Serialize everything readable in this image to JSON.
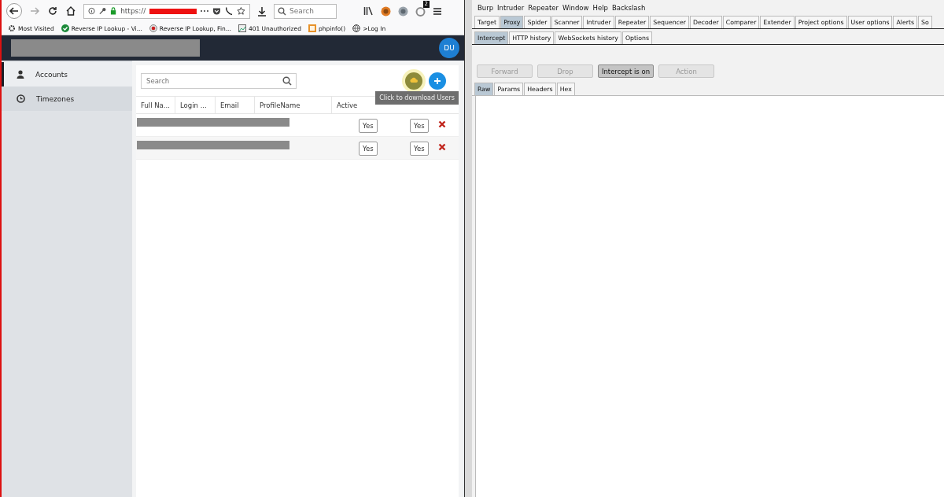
{
  "browser": {
    "url": "https://",
    "search": {
      "placeholder": "Search"
    },
    "badge": "2",
    "bookmarks": [
      {
        "kind": "gear",
        "label": "Most Visited"
      },
      {
        "kind": "check",
        "label": "Reverse IP Lookup - Vi..."
      },
      {
        "kind": "target",
        "label": "Reverse IP Lookup, Fin..."
      },
      {
        "kind": "image",
        "label": "401 Unauthorized"
      },
      {
        "kind": "php",
        "label": "phpinfo()"
      },
      {
        "kind": "globe",
        "label": ">Log In"
      }
    ]
  },
  "app": {
    "avatar": "DU",
    "sidebar": [
      {
        "kind": "user",
        "label": "Accounts",
        "selected": true
      },
      {
        "kind": "clock",
        "label": "Timezones",
        "selected": false
      }
    ],
    "search": {
      "placeholder": "Search"
    },
    "tooltip": "Click to download Users",
    "columns": [
      "Full Na...",
      "Login ...",
      "Email",
      "ProfileName",
      "Active"
    ],
    "rows": [
      {
        "active": "Yes",
        "action": "Yes"
      },
      {
        "active": "Yes",
        "action": "Yes"
      }
    ]
  },
  "burp": {
    "menu": [
      "Burp",
      "Intruder",
      "Repeater",
      "Window",
      "Help",
      "Backslash"
    ],
    "tabs": [
      {
        "label": "Target",
        "selected": false
      },
      {
        "label": "Proxy",
        "selected": true
      },
      {
        "label": "Spider",
        "selected": false
      },
      {
        "label": "Scanner",
        "selected": false
      },
      {
        "label": "Intruder",
        "selected": false
      },
      {
        "label": "Repeater",
        "selected": false
      },
      {
        "label": "Sequencer",
        "selected": false
      },
      {
        "label": "Decoder",
        "selected": false
      },
      {
        "label": "Comparer",
        "selected": false
      },
      {
        "label": "Extender",
        "selected": false
      },
      {
        "label": "Project options",
        "selected": false
      },
      {
        "label": "User options",
        "selected": false
      },
      {
        "label": "Alerts",
        "selected": false
      },
      {
        "label": "So",
        "selected": false
      }
    ],
    "subtabs": [
      {
        "label": "Intercept",
        "selected": true
      },
      {
        "label": "HTTP history",
        "selected": false
      },
      {
        "label": "WebSockets history",
        "selected": false
      },
      {
        "label": "Options",
        "selected": false
      }
    ],
    "buttons": [
      {
        "label": "Forward",
        "disabled": true
      },
      {
        "label": "Drop",
        "disabled": true
      },
      {
        "label": "Intercept is on",
        "disabled": false
      },
      {
        "label": "Action",
        "disabled": true
      }
    ],
    "message_tabs": [
      {
        "label": "Raw",
        "selected": true
      },
      {
        "label": "Params",
        "selected": false
      },
      {
        "label": "Headers",
        "selected": false
      },
      {
        "label": "Hex",
        "selected": false
      }
    ]
  }
}
